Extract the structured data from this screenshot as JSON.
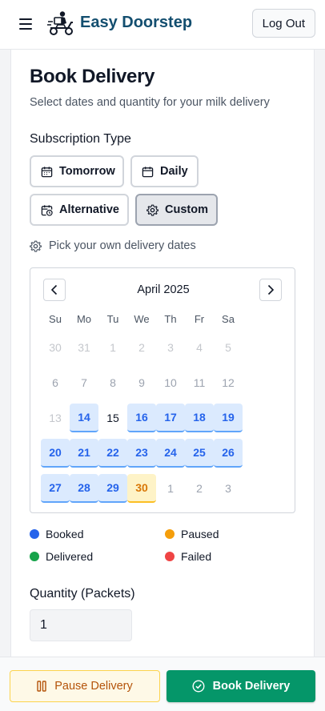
{
  "header": {
    "brand": "Easy Doorstep",
    "logout_label": "Log Out",
    "menu_icon": "hamburger-menu-icon",
    "logo_icon": "delivery-scooter-logo"
  },
  "page": {
    "title": "Book Delivery",
    "subtitle": "Select dates and quantity for your milk delivery"
  },
  "subscription": {
    "label": "Subscription Type",
    "options": [
      {
        "label": "Tomorrow",
        "icon": "calendar-icon",
        "active": false
      },
      {
        "label": "Daily",
        "icon": "calendar-icon",
        "active": false
      },
      {
        "label": "Alternative",
        "icon": "calendar-clock-icon",
        "active": false
      },
      {
        "label": "Custom",
        "icon": "gear-icon",
        "active": true
      }
    ],
    "hint": "Pick your own delivery dates"
  },
  "calendar": {
    "month": "April 2025",
    "weekdays": [
      "Su",
      "Mo",
      "Tu",
      "We",
      "Th",
      "Fr",
      "Sa"
    ],
    "weeks": [
      [
        {
          "d": "30",
          "s": "muted"
        },
        {
          "d": "31",
          "s": "muted"
        },
        {
          "d": "1",
          "s": "muted"
        },
        {
          "d": "2",
          "s": "muted"
        },
        {
          "d": "3",
          "s": "muted"
        },
        {
          "d": "4",
          "s": "muted"
        },
        {
          "d": "5",
          "s": "muted"
        }
      ],
      [
        {
          "d": "6",
          "s": "past"
        },
        {
          "d": "7",
          "s": "past"
        },
        {
          "d": "8",
          "s": "past"
        },
        {
          "d": "9",
          "s": "past"
        },
        {
          "d": "10",
          "s": "past"
        },
        {
          "d": "11",
          "s": "past"
        },
        {
          "d": "12",
          "s": "past"
        }
      ],
      [
        {
          "d": "13",
          "s": "muted"
        },
        {
          "d": "14",
          "s": "booked"
        },
        {
          "d": "15",
          "s": "today"
        },
        {
          "d": "16",
          "s": "booked"
        },
        {
          "d": "17",
          "s": "booked"
        },
        {
          "d": "18",
          "s": "booked"
        },
        {
          "d": "19",
          "s": "booked"
        }
      ],
      [
        {
          "d": "20",
          "s": "booked"
        },
        {
          "d": "21",
          "s": "booked"
        },
        {
          "d": "22",
          "s": "booked"
        },
        {
          "d": "23",
          "s": "booked"
        },
        {
          "d": "24",
          "s": "booked"
        },
        {
          "d": "25",
          "s": "booked"
        },
        {
          "d": "26",
          "s": "booked"
        }
      ],
      [
        {
          "d": "27",
          "s": "booked"
        },
        {
          "d": "28",
          "s": "booked"
        },
        {
          "d": "29",
          "s": "booked"
        },
        {
          "d": "30",
          "s": "paused"
        },
        {
          "d": "1",
          "s": "past"
        },
        {
          "d": "2",
          "s": "past"
        },
        {
          "d": "3",
          "s": "past"
        }
      ]
    ]
  },
  "legend": [
    {
      "label": "Booked",
      "color": "#2563eb"
    },
    {
      "label": "Paused",
      "color": "#f59e0b"
    },
    {
      "label": "Delivered",
      "color": "#16a34a"
    },
    {
      "label": "Failed",
      "color": "#ef4444"
    }
  ],
  "quantity": {
    "label": "Quantity (Packets)",
    "value": "1"
  },
  "actions": {
    "pause_label": "Pause Delivery",
    "book_label": "Book Delivery"
  }
}
